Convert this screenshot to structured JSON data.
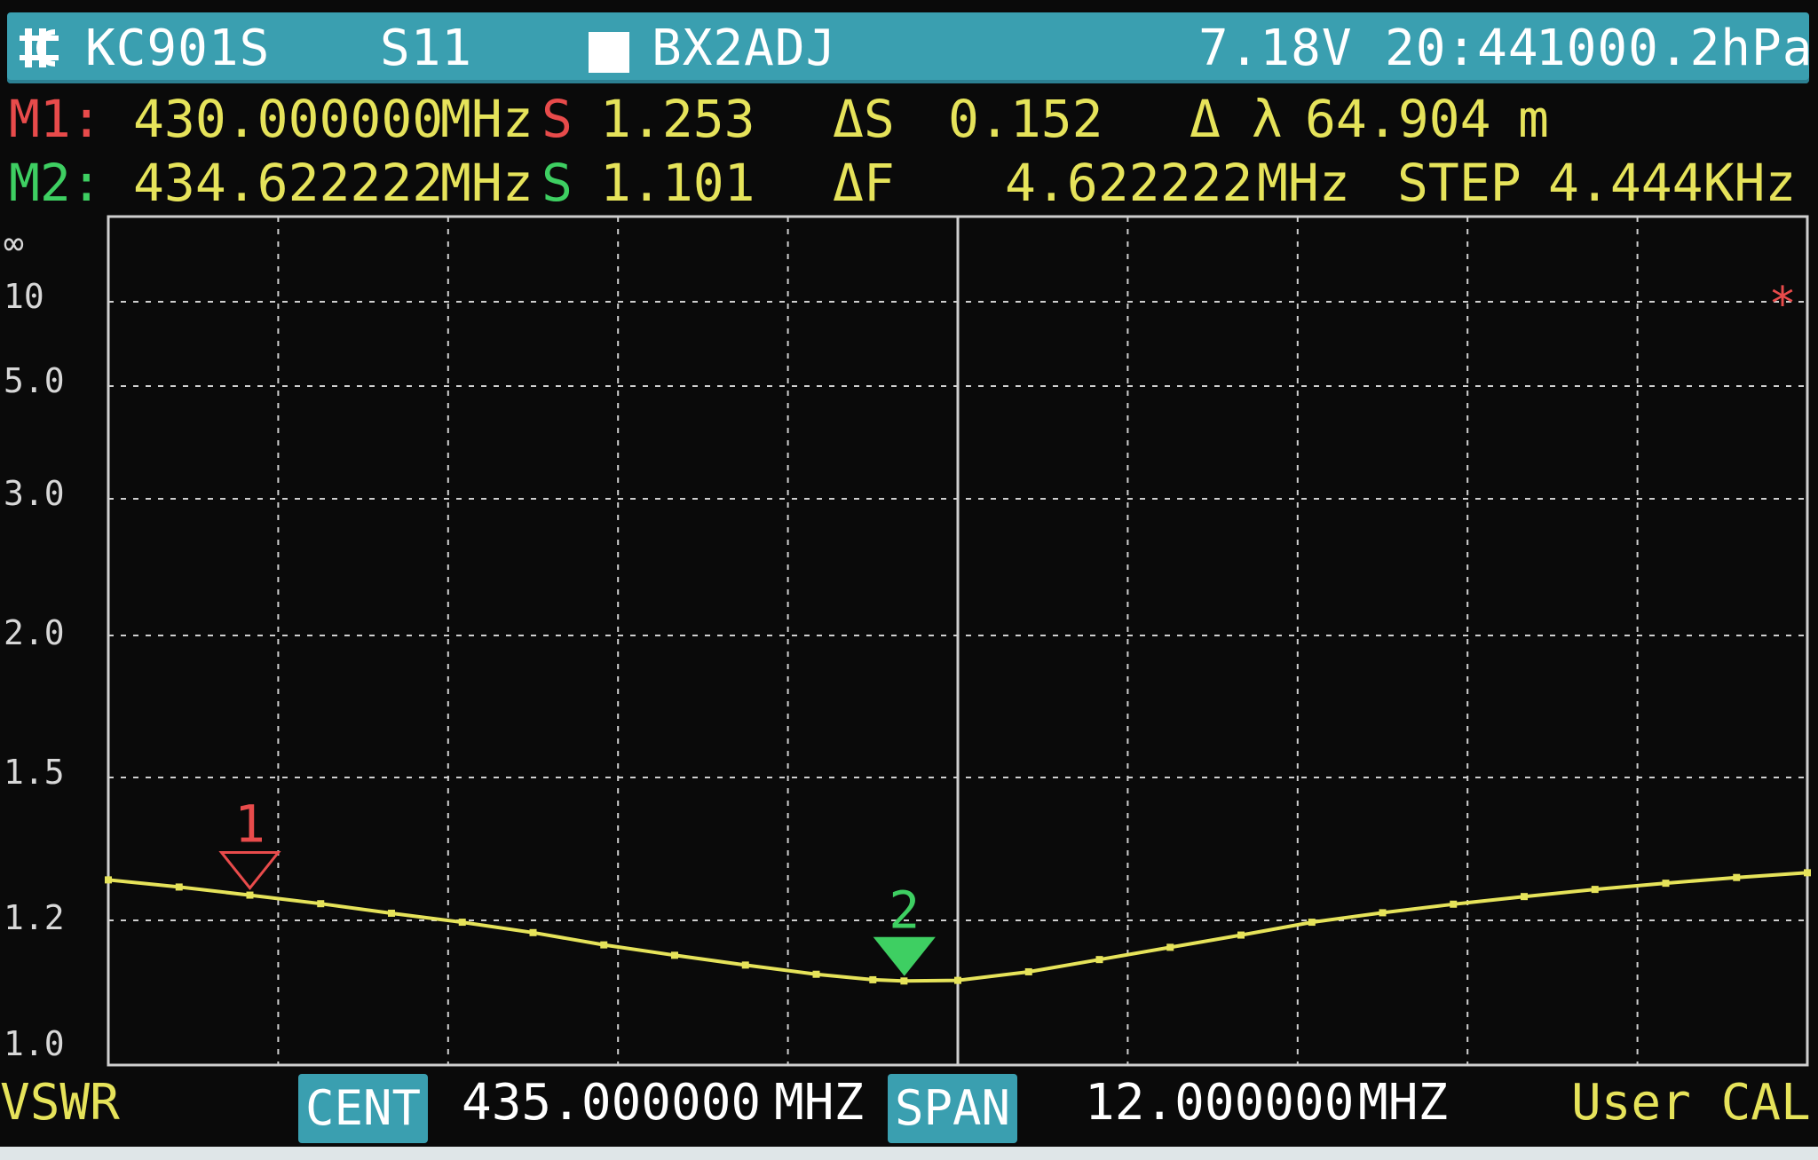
{
  "header": {
    "device": "KC901S",
    "mode": "S11",
    "callsign": "BX2ADJ",
    "voltage": "7.18V",
    "time": "20:44",
    "pressure": "1000.2hPa"
  },
  "markers": {
    "m1": {
      "label": "M1:",
      "freq": "430.000000",
      "unit": "MHz",
      "s_label": "S",
      "s_value": "1.253"
    },
    "m2": {
      "label": "M2:",
      "freq": "434.622222",
      "unit": "MHz",
      "s_label": "S",
      "s_value": "1.101"
    },
    "delta_s_label": "ΔS",
    "delta_s": "0.152",
    "delta_lambda_label": "Δ λ",
    "delta_lambda": "64.904",
    "delta_lambda_unit": "m",
    "delta_f_label": "ΔF",
    "delta_f": "4.622222",
    "delta_f_unit": "MHz",
    "step_label": "STEP",
    "step": "4.444KHz"
  },
  "footer": {
    "measurement": "VSWR",
    "cent_label": "CENT",
    "cent_value": "435.000000",
    "cent_unit": "MHZ",
    "span_label": "SPAN",
    "span_value": "12.000000",
    "span_unit": "MHZ",
    "cal": "User CAL"
  },
  "colors": {
    "trace": "#e6e35a",
    "marker1": "#e84b4b",
    "marker2": "#3ecf62",
    "accent": "#3a9fb0"
  },
  "chart_data": {
    "type": "line",
    "title": "",
    "xlabel": "",
    "ylabel": "VSWR",
    "x_unit": "MHz",
    "xlim": [
      429,
      441
    ],
    "y_scale": "vswr-nonlinear",
    "y_ticks": [
      "∞",
      "10",
      "5.0",
      "3.0",
      "2.0",
      "1.5",
      "1.2",
      "1.0"
    ],
    "grid": true,
    "series": [
      {
        "x": [
          429.0,
          429.5,
          430.0,
          430.5,
          431.0,
          431.5,
          432.0,
          432.5,
          433.0,
          433.5,
          434.0,
          434.4,
          434.62,
          435.0,
          435.5,
          436.0,
          436.5,
          437.0,
          437.5,
          438.0,
          438.5,
          439.0,
          439.5,
          440.0,
          440.5,
          441.0
        ],
        "y": [
          1.285,
          1.27,
          1.253,
          1.235,
          1.215,
          1.197,
          1.18,
          1.16,
          1.143,
          1.127,
          1.112,
          1.103,
          1.101,
          1.102,
          1.116,
          1.136,
          1.156,
          1.176,
          1.197,
          1.216,
          1.234,
          1.25,
          1.265,
          1.278,
          1.29,
          1.3
        ]
      }
    ],
    "markers": [
      {
        "id": "1",
        "x": 430.0,
        "y": 1.253
      },
      {
        "id": "2",
        "x": 434.622222,
        "y": 1.101
      }
    ],
    "reference_marker": {
      "symbol": "*",
      "y": 10
    }
  }
}
